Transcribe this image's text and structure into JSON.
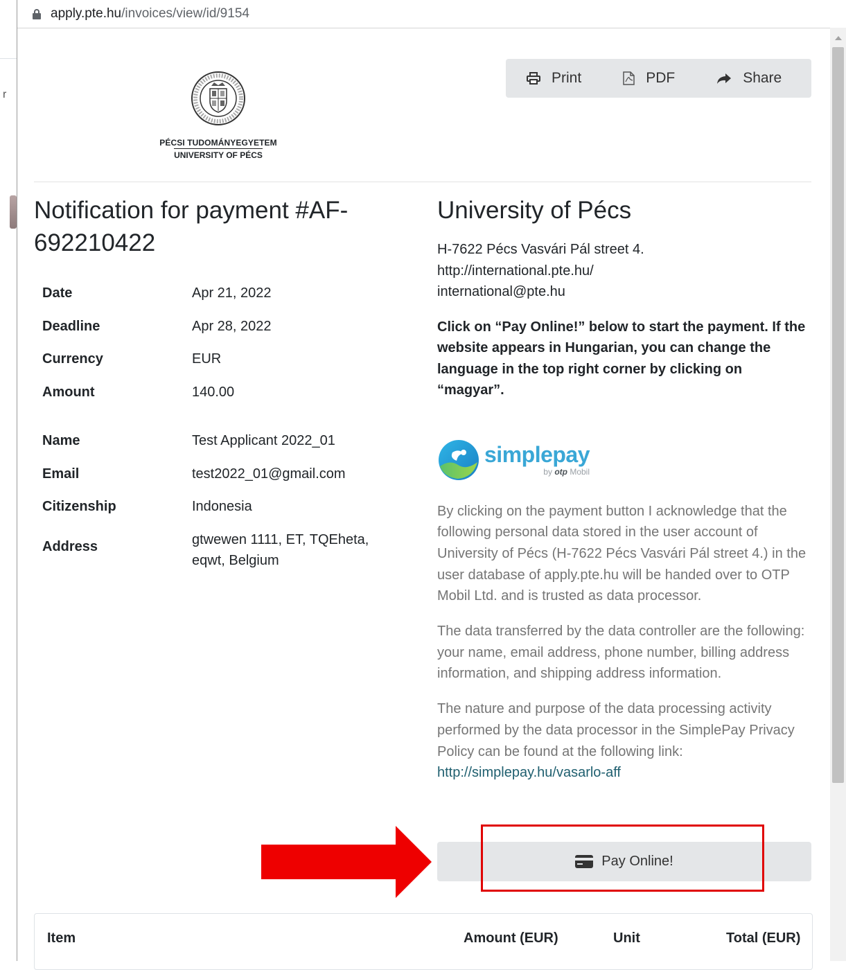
{
  "browser": {
    "url_host": "apply.pte.hu",
    "url_path": "/invoices/view/id/9154"
  },
  "logo": {
    "line1": "PÉCSI TUDOMÁNYEGYETEM",
    "line2": "UNIVERSITY OF PÉCS",
    "seal_text": "UNIVERSITAS QUINQUEECCLESIENSIS"
  },
  "toolbar": {
    "print_label": "Print",
    "pdf_label": "PDF",
    "share_label": "Share"
  },
  "invoice": {
    "title": "Notification for payment #AF-692210422",
    "rows": [
      {
        "label": "Date",
        "value": "Apr 21, 2022"
      },
      {
        "label": "Deadline",
        "value": "Apr 28, 2022"
      },
      {
        "label": "Currency",
        "value": "EUR"
      },
      {
        "label": "Amount",
        "value": "140.00"
      }
    ],
    "person": [
      {
        "label": "Name",
        "value": "Test Applicant 2022_01"
      },
      {
        "label": "Email",
        "value": "test2022_01@gmail.com"
      },
      {
        "label": "Citizenship",
        "value": "Indonesia"
      },
      {
        "label": "Address",
        "value": "gtwewen 1111, ET, TQEheta, eqwt, Belgium"
      }
    ]
  },
  "org": {
    "name": "University of Pécs",
    "address": "H-7622 Pécs Vasvári Pál street 4.",
    "website": "http://international.pte.hu/",
    "email": "international@pte.hu",
    "instructions": "Click on “Pay Online!” below to start the payment. If the website appears in Hungarian, you can change the language in the top right corner by clicking on “magyar”."
  },
  "simplepay": {
    "brand": "simplepay",
    "by": "by",
    "otp": "otp",
    "mobil": "Mobil"
  },
  "consent": {
    "p1": "By clicking on the payment button I acknowledge that the following personal data stored in the user account of University of Pécs (H-7622 Pécs Vasvári Pál street 4.) in the user database of apply.pte.hu will be handed over to OTP Mobil Ltd. and is trusted as data processor.",
    "p2": "The data transferred by the data controller are the following: your name, email address, phone number, billing address information, and shipping address information.",
    "p3": "The nature and purpose of the data processing activity performed by the data processor in the SimplePay Privacy Policy can be found at the following link:",
    "link": "http://simplepay.hu/vasarlo-aff"
  },
  "pay_button": {
    "label": "Pay Online!"
  },
  "items_table": {
    "headers": [
      "Item",
      "Amount (EUR)",
      "Unit",
      "Total (EUR)"
    ]
  },
  "colors": {
    "annotation_red": "#e00000",
    "button_gray": "#e4e6e8",
    "simplepay_blue": "#3aa7d6"
  }
}
